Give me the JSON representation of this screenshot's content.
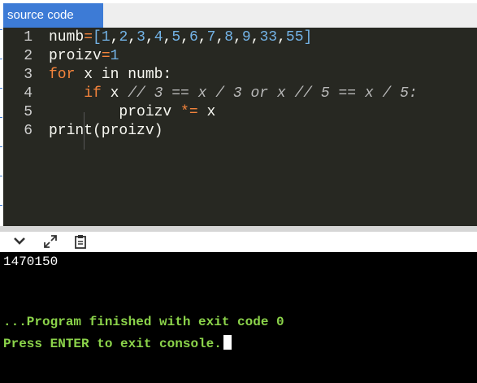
{
  "tab": {
    "label": "source code"
  },
  "editor": {
    "line_numbers": [
      "1",
      "2",
      "3",
      "4",
      "5",
      "6"
    ],
    "lines": [
      {
        "tokens": [
          {
            "t": "numb",
            "c": "id"
          },
          {
            "t": "=",
            "c": "op"
          },
          {
            "t": "[",
            "c": "br"
          },
          {
            "t": "1",
            "c": "num"
          },
          {
            "t": ",",
            "c": "id"
          },
          {
            "t": "2",
            "c": "num"
          },
          {
            "t": ",",
            "c": "id"
          },
          {
            "t": "3",
            "c": "num"
          },
          {
            "t": ",",
            "c": "id"
          },
          {
            "t": "4",
            "c": "num"
          },
          {
            "t": ",",
            "c": "id"
          },
          {
            "t": "5",
            "c": "num"
          },
          {
            "t": ",",
            "c": "id"
          },
          {
            "t": "6",
            "c": "num"
          },
          {
            "t": ",",
            "c": "id"
          },
          {
            "t": "7",
            "c": "num"
          },
          {
            "t": ",",
            "c": "id"
          },
          {
            "t": "8",
            "c": "num"
          },
          {
            "t": ",",
            "c": "id"
          },
          {
            "t": "9",
            "c": "num"
          },
          {
            "t": ",",
            "c": "id"
          },
          {
            "t": "33",
            "c": "num"
          },
          {
            "t": ",",
            "c": "id"
          },
          {
            "t": "55",
            "c": "num"
          },
          {
            "t": "]",
            "c": "br"
          }
        ]
      },
      {
        "tokens": [
          {
            "t": "proizv",
            "c": "id"
          },
          {
            "t": "=",
            "c": "op"
          },
          {
            "t": "1",
            "c": "num"
          }
        ]
      },
      {
        "tokens": [
          {
            "t": "for",
            "c": "kw"
          },
          {
            "t": " x in numb:",
            "c": "id"
          }
        ]
      },
      {
        "tokens": [
          {
            "t": "    ",
            "c": "id"
          },
          {
            "t": "if",
            "c": "kw"
          },
          {
            "t": " x ",
            "c": "id"
          },
          {
            "t": "// 3 == x / 3 or x // 5 == x / 5:",
            "c": "cmt"
          }
        ]
      },
      {
        "tokens": [
          {
            "t": "        proizv ",
            "c": "id"
          },
          {
            "t": "*=",
            "c": "op"
          },
          {
            "t": " x",
            "c": "id"
          }
        ]
      },
      {
        "tokens": [
          {
            "t": "print(proizv)",
            "c": "id"
          }
        ]
      }
    ]
  },
  "console_toolbar": {
    "collapse_icon": "chevron-down-icon",
    "expand_icon": "expand-arrows-icon",
    "copy_icon": "copy-clipboard-icon"
  },
  "console": {
    "output": "1470150",
    "finished": "...Program finished with exit code 0",
    "press_enter": "Press ENTER to exit console."
  },
  "colors": {
    "tab_blue": "#3d7bd6",
    "editor_bg": "#272822",
    "keyword": "#f5843c",
    "number": "#73b3e6",
    "console_msg": "#8bd34a"
  }
}
